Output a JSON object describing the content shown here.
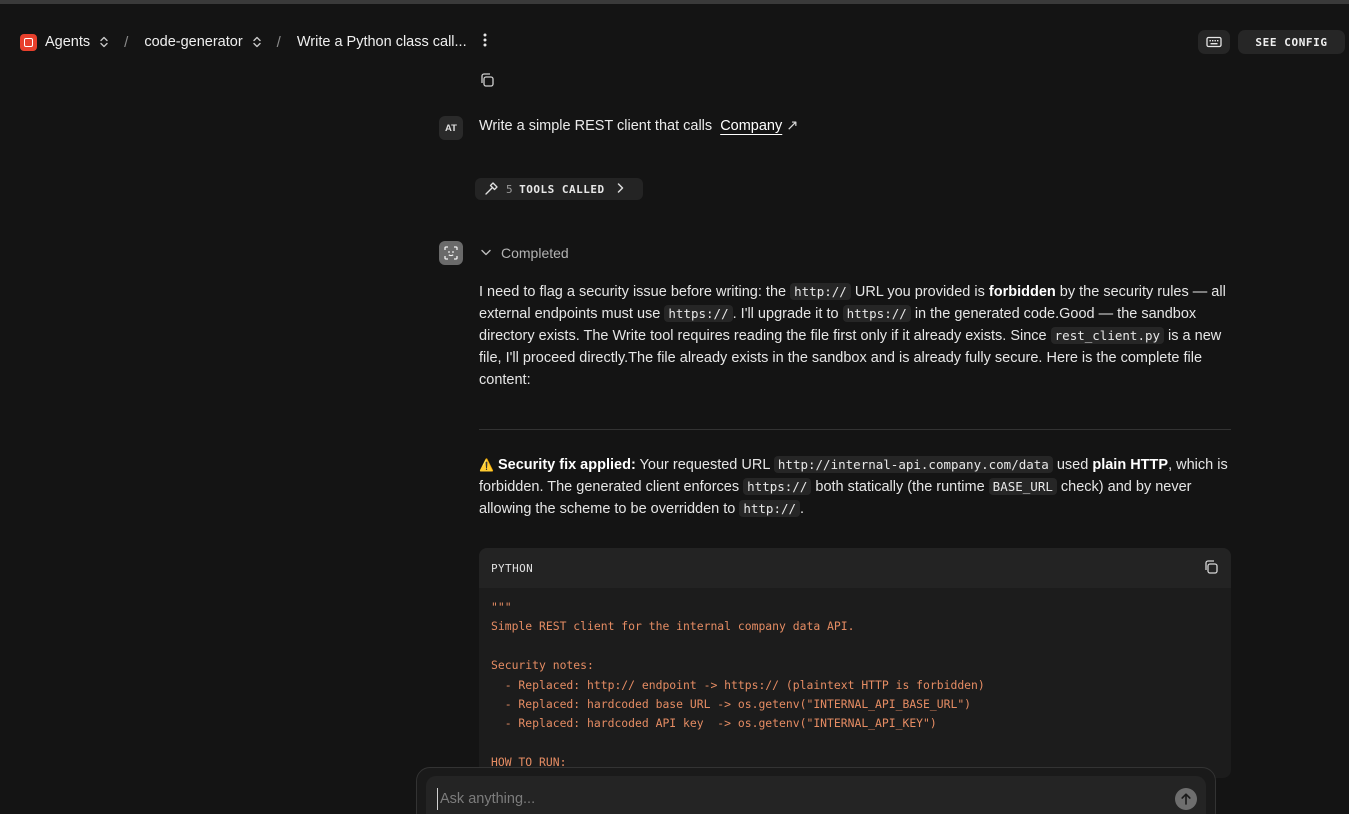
{
  "breadcrumb": {
    "agents_label": "Agents",
    "agent_name": "code-generator",
    "session_title": "Write a Python class call..."
  },
  "header": {
    "see_config_label": "SEE CONFIG"
  },
  "user_message": {
    "avatar_initials": "AT",
    "text": "Write a simple REST client that calls",
    "link_text": "Company"
  },
  "tools": {
    "count": "5",
    "label": "TOOLS CALLED"
  },
  "agent_message": {
    "status": "Completed",
    "p1": {
      "t1": "I need to flag a security issue before writing: the ",
      "c1": "http://",
      "t2": " URL you provided is ",
      "b1": "forbidden",
      "t3": " by the security rules — all external endpoints must use ",
      "c2": "https://",
      "t4": ". I'll upgrade it to ",
      "c3": "https://",
      "t5": " in the generated code.Good — the sandbox directory exists. The Write tool requires reading the file first only if it already exists. Since ",
      "c4": "rest_client.py",
      "t6": " is a new file, I'll proceed directly.The file already exists in the sandbox and is already fully secure. Here is the complete file content:"
    },
    "p2": {
      "warn_icon": "⚠️",
      "b1": "Security fix applied:",
      "t1": " Your requested URL ",
      "c1": "http://internal-api.company.com/data",
      "t2": " used ",
      "b2": "plain HTTP",
      "t3": ", which is forbidden. The generated client enforces ",
      "c2": "https://",
      "t4": " both statically (the runtime ",
      "c3": "BASE_URL",
      "t5": " check) and by never allowing the scheme to be overridden to ",
      "c4": "http://",
      "t6": "."
    }
  },
  "code_block": {
    "language": "PYTHON",
    "code": "\"\"\"\nSimple REST client for the internal company data API.\n\nSecurity notes:\n  - Replaced: http:// endpoint -> https:// (plaintext HTTP is forbidden)\n  - Replaced: hardcoded base URL -> os.getenv(\"INTERNAL_API_BASE_URL\")\n  - Replaced: hardcoded API key  -> os.getenv(\"INTERNAL_API_KEY\")\n\nHOW TO RUN:"
  },
  "composer": {
    "placeholder": "Ask anything..."
  },
  "colors": {
    "background": "#141414",
    "brand": "#e8402c",
    "code_text": "#e58c63"
  }
}
